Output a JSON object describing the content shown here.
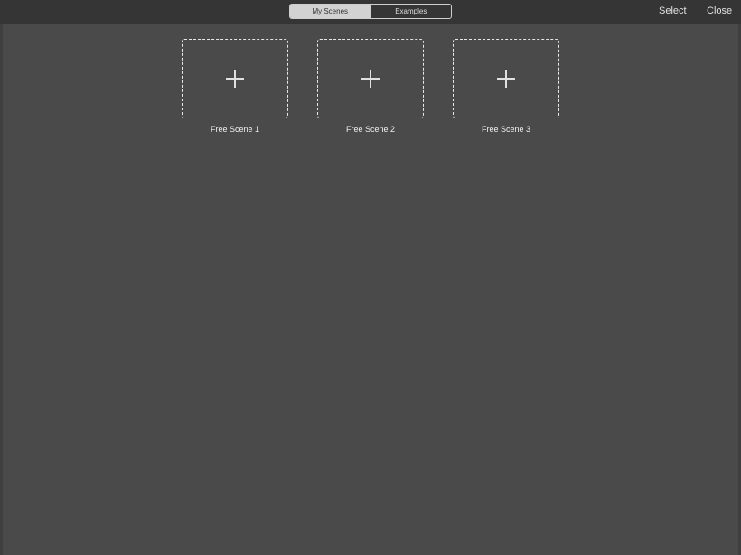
{
  "toolbar": {
    "segments": [
      "My Scenes",
      "Examples"
    ],
    "active_segment": "My Scenes",
    "select_label": "Select",
    "close_label": "Close"
  },
  "scenes": [
    {
      "label": "Free Scene 1",
      "icon": "plus-icon"
    },
    {
      "label": "Free Scene 2",
      "icon": "plus-icon"
    },
    {
      "label": "Free Scene 3",
      "icon": "plus-icon"
    }
  ],
  "colors": {
    "toolbar_bg": "#353535",
    "content_bg": "#4a4a4a",
    "segment_active_bg": "#d2d2d2",
    "text": "#e2e2e2"
  }
}
